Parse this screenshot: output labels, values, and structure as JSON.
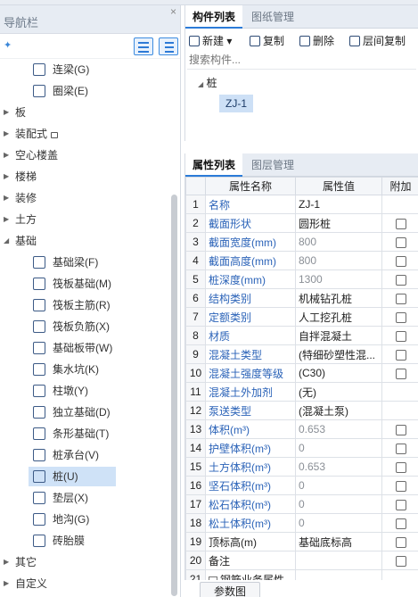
{
  "nav": {
    "title": "导航栏",
    "close_glyph": "×",
    "tree": [
      {
        "label": "连梁(G)",
        "level": 1,
        "icon": "coupling-beam-icon"
      },
      {
        "label": "圈梁(E)",
        "level": 1,
        "icon": "ring-beam-icon"
      },
      {
        "label": "板",
        "level": 0
      },
      {
        "label": "装配式",
        "level": 0,
        "lock": true
      },
      {
        "label": "空心楼盖",
        "level": 0
      },
      {
        "label": "楼梯",
        "level": 0
      },
      {
        "label": "装修",
        "level": 0
      },
      {
        "label": "土方",
        "level": 0
      },
      {
        "label": "基础",
        "level": 0,
        "expanded": true
      },
      {
        "label": "基础梁(F)",
        "level": 1,
        "icon": "foundation-beam-icon"
      },
      {
        "label": "筏板基础(M)",
        "level": 1,
        "icon": "raft-foundation-icon"
      },
      {
        "label": "筏板主筋(R)",
        "level": 1,
        "icon": "raft-main-rebar-icon"
      },
      {
        "label": "筏板负筋(X)",
        "level": 1,
        "icon": "raft-negative-rebar-icon"
      },
      {
        "label": "基础板带(W)",
        "level": 1,
        "icon": "foundation-strip-icon"
      },
      {
        "label": "集水坑(K)",
        "level": 1,
        "icon": "sump-pit-icon"
      },
      {
        "label": "柱墩(Y)",
        "level": 1,
        "icon": "column-pier-icon"
      },
      {
        "label": "独立基础(D)",
        "level": 1,
        "icon": "isolated-foundation-icon"
      },
      {
        "label": "条形基础(T)",
        "level": 1,
        "icon": "strip-foundation-icon"
      },
      {
        "label": "桩承台(V)",
        "level": 1,
        "icon": "pile-cap-icon"
      },
      {
        "label": "桩(U)",
        "level": 1,
        "icon": "pile-icon",
        "selected": true
      },
      {
        "label": "垫层(X)",
        "level": 1,
        "icon": "cushion-layer-icon"
      },
      {
        "label": "地沟(G)",
        "level": 1,
        "icon": "trench-icon"
      },
      {
        "label": "砖胎膜",
        "level": 1,
        "icon": "brick-mold-icon"
      },
      {
        "label": "其它",
        "level": 0
      },
      {
        "label": "自定义",
        "level": 0
      }
    ]
  },
  "component_panel": {
    "tabs": [
      "构件列表",
      "图纸管理"
    ],
    "active_tab": 0,
    "toolbar": {
      "new_label": "新建",
      "copy_label": "复制",
      "delete_label": "删除",
      "floor_copy_label": "层间复制"
    },
    "search_placeholder": "搜索构件...",
    "group_label": "桩",
    "item_label": "ZJ-1"
  },
  "property_panel": {
    "tabs": [
      "属性列表",
      "图层管理"
    ],
    "active_tab": 0,
    "columns": [
      "",
      "属性名称",
      "属性值",
      "附加"
    ],
    "rows": [
      {
        "n": "1",
        "name": "名称",
        "value": "ZJ-1",
        "blue": true,
        "gray": false,
        "check": false
      },
      {
        "n": "2",
        "name": "截面形状",
        "value": "圆形桩",
        "blue": true,
        "gray": false,
        "check": true
      },
      {
        "n": "3",
        "name": "截面宽度(mm)",
        "value": "800",
        "blue": true,
        "gray": true,
        "check": true
      },
      {
        "n": "4",
        "name": "截面高度(mm)",
        "value": "800",
        "blue": true,
        "gray": true,
        "check": true
      },
      {
        "n": "5",
        "name": "桩深度(mm)",
        "value": "1300",
        "blue": true,
        "gray": true,
        "check": true
      },
      {
        "n": "6",
        "name": "结构类别",
        "value": "机械钻孔桩",
        "blue": true,
        "gray": false,
        "check": true
      },
      {
        "n": "7",
        "name": "定额类别",
        "value": "人工挖孔桩",
        "blue": true,
        "gray": false,
        "check": true
      },
      {
        "n": "8",
        "name": "材质",
        "value": "自拌混凝土",
        "blue": true,
        "gray": false,
        "check": true
      },
      {
        "n": "9",
        "name": "混凝土类型",
        "value": "(特细砂塑性混...",
        "blue": true,
        "gray": false,
        "check": true
      },
      {
        "n": "10",
        "name": "混凝土强度等级",
        "value": "(C30)",
        "blue": true,
        "gray": false,
        "check": true
      },
      {
        "n": "11",
        "name": "混凝土外加剂",
        "value": "(无)",
        "blue": true,
        "gray": false,
        "check": false
      },
      {
        "n": "12",
        "name": "泵送类型",
        "value": "(混凝土泵)",
        "blue": true,
        "gray": false,
        "check": false
      },
      {
        "n": "13",
        "name": "体积(m³)",
        "value": "0.653",
        "blue": true,
        "gray": true,
        "check": true
      },
      {
        "n": "14",
        "name": "护壁体积(m³)",
        "value": "0",
        "blue": true,
        "gray": true,
        "check": true
      },
      {
        "n": "15",
        "name": "土方体积(m³)",
        "value": "0.653",
        "blue": true,
        "gray": true,
        "check": true
      },
      {
        "n": "16",
        "name": "坚石体积(m³)",
        "value": "0",
        "blue": true,
        "gray": true,
        "check": true
      },
      {
        "n": "17",
        "name": "松石体积(m³)",
        "value": "0",
        "blue": true,
        "gray": true,
        "check": true
      },
      {
        "n": "18",
        "name": "松土体积(m³)",
        "value": "0",
        "blue": true,
        "gray": true,
        "check": true
      },
      {
        "n": "19",
        "name": "顶标高(m)",
        "value": "基础底标高",
        "blue": false,
        "gray": false,
        "check": true
      },
      {
        "n": "20",
        "name": "备注",
        "value": "",
        "blue": false,
        "gray": false,
        "check": true
      },
      {
        "n": "21",
        "name": "钢筋业务属性",
        "value": "",
        "blue": false,
        "gray": false,
        "check": false,
        "group": true
      }
    ]
  },
  "bottom_button_label": "参数图",
  "colors": {
    "accent": "#2b7bd8",
    "selection": "#cde0f6",
    "property_name_blue": "#2b63b8"
  }
}
